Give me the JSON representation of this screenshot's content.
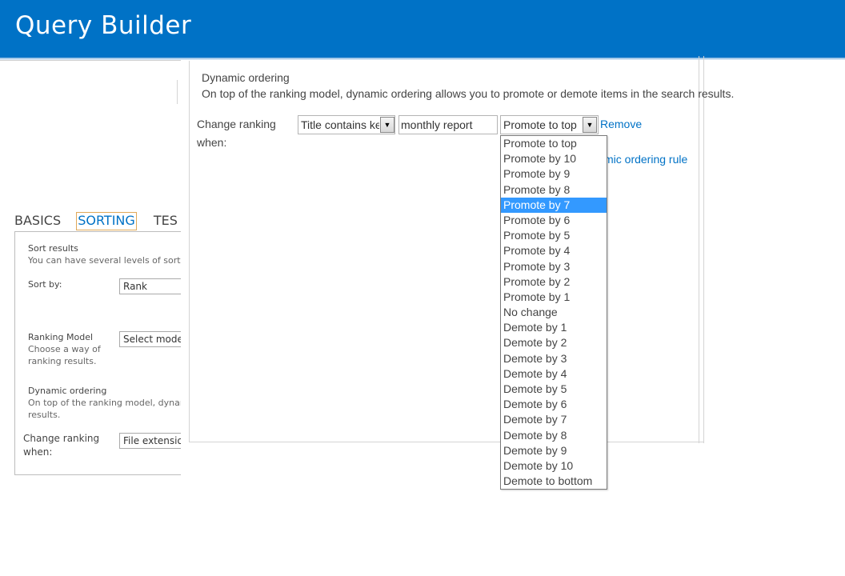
{
  "header": {
    "title": "Query Builder"
  },
  "background": {
    "tabs": [
      {
        "label": "BASICS",
        "active": false
      },
      {
        "label": "SORTING",
        "active": true
      },
      {
        "label": "TES",
        "active": false
      }
    ],
    "sort_results_title": "Sort results",
    "sort_results_desc": "You can have several levels of sortin",
    "sort_by_label": "Sort by:",
    "sort_by_value": "Rank",
    "ranking_model_label": "Ranking Model",
    "ranking_model_desc1": "Choose a way of",
    "ranking_model_desc2": "ranking results.",
    "ranking_model_value": "Select mode",
    "dynamic_ordering_title": "Dynamic ordering",
    "dynamic_ordering_desc1": "On top of the ranking model, dynan",
    "dynamic_ordering_desc2": "results.",
    "change_ranking_label1": "Change ranking",
    "change_ranking_label2": "when:",
    "change_ranking_value": "File extensio"
  },
  "dialog": {
    "section_title": "Dynamic ordering",
    "section_desc": "On top of the ranking model, dynamic ordering allows you to promote or demote items in the search results.",
    "change_ranking_label1": "Change ranking",
    "change_ranking_label2": "when:",
    "condition_value": "Title contains ke",
    "keyword_value": "monthly report",
    "action_value": "Promote to top",
    "remove_link": "Remove",
    "add_rule_link": "mic ordering rule"
  },
  "dropdown": {
    "selected": "Promote by 7",
    "options": [
      "Promote to top",
      "Promote by 10",
      "Promote by 9",
      "Promote by 8",
      "Promote by 7",
      "Promote by 6",
      "Promote by 5",
      "Promote by 4",
      "Promote by 3",
      "Promote by 2",
      "Promote by 1",
      "No change",
      "Demote by 1",
      "Demote by 2",
      "Demote by 3",
      "Demote by 4",
      "Demote by 5",
      "Demote by 6",
      "Demote by 7",
      "Demote by 8",
      "Demote by 9",
      "Demote by 10",
      "Demote to bottom"
    ]
  },
  "colors": {
    "brand": "#0072c6",
    "selection": "#3399ff",
    "link": "#0072c6"
  },
  "icons": {
    "dropdown_arrow": "triangle-down-icon"
  }
}
